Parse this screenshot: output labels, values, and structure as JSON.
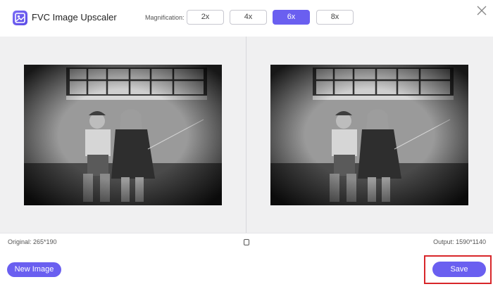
{
  "app": {
    "title": "FVC Image Upscaler",
    "logo_icon": "image-upscaler-logo-icon",
    "accent_color": "#6a5ff0"
  },
  "magnification": {
    "label": "Magnification:",
    "options": [
      "2x",
      "4x",
      "6x",
      "8x"
    ],
    "selected": "6x"
  },
  "window": {
    "close_icon": "close-icon"
  },
  "info": {
    "original": "Original: 265*190",
    "output": "Output: 1590*1140"
  },
  "footer": {
    "new_image_label": "New Image",
    "save_label": "Save",
    "highlight_color": "#d8262a"
  }
}
